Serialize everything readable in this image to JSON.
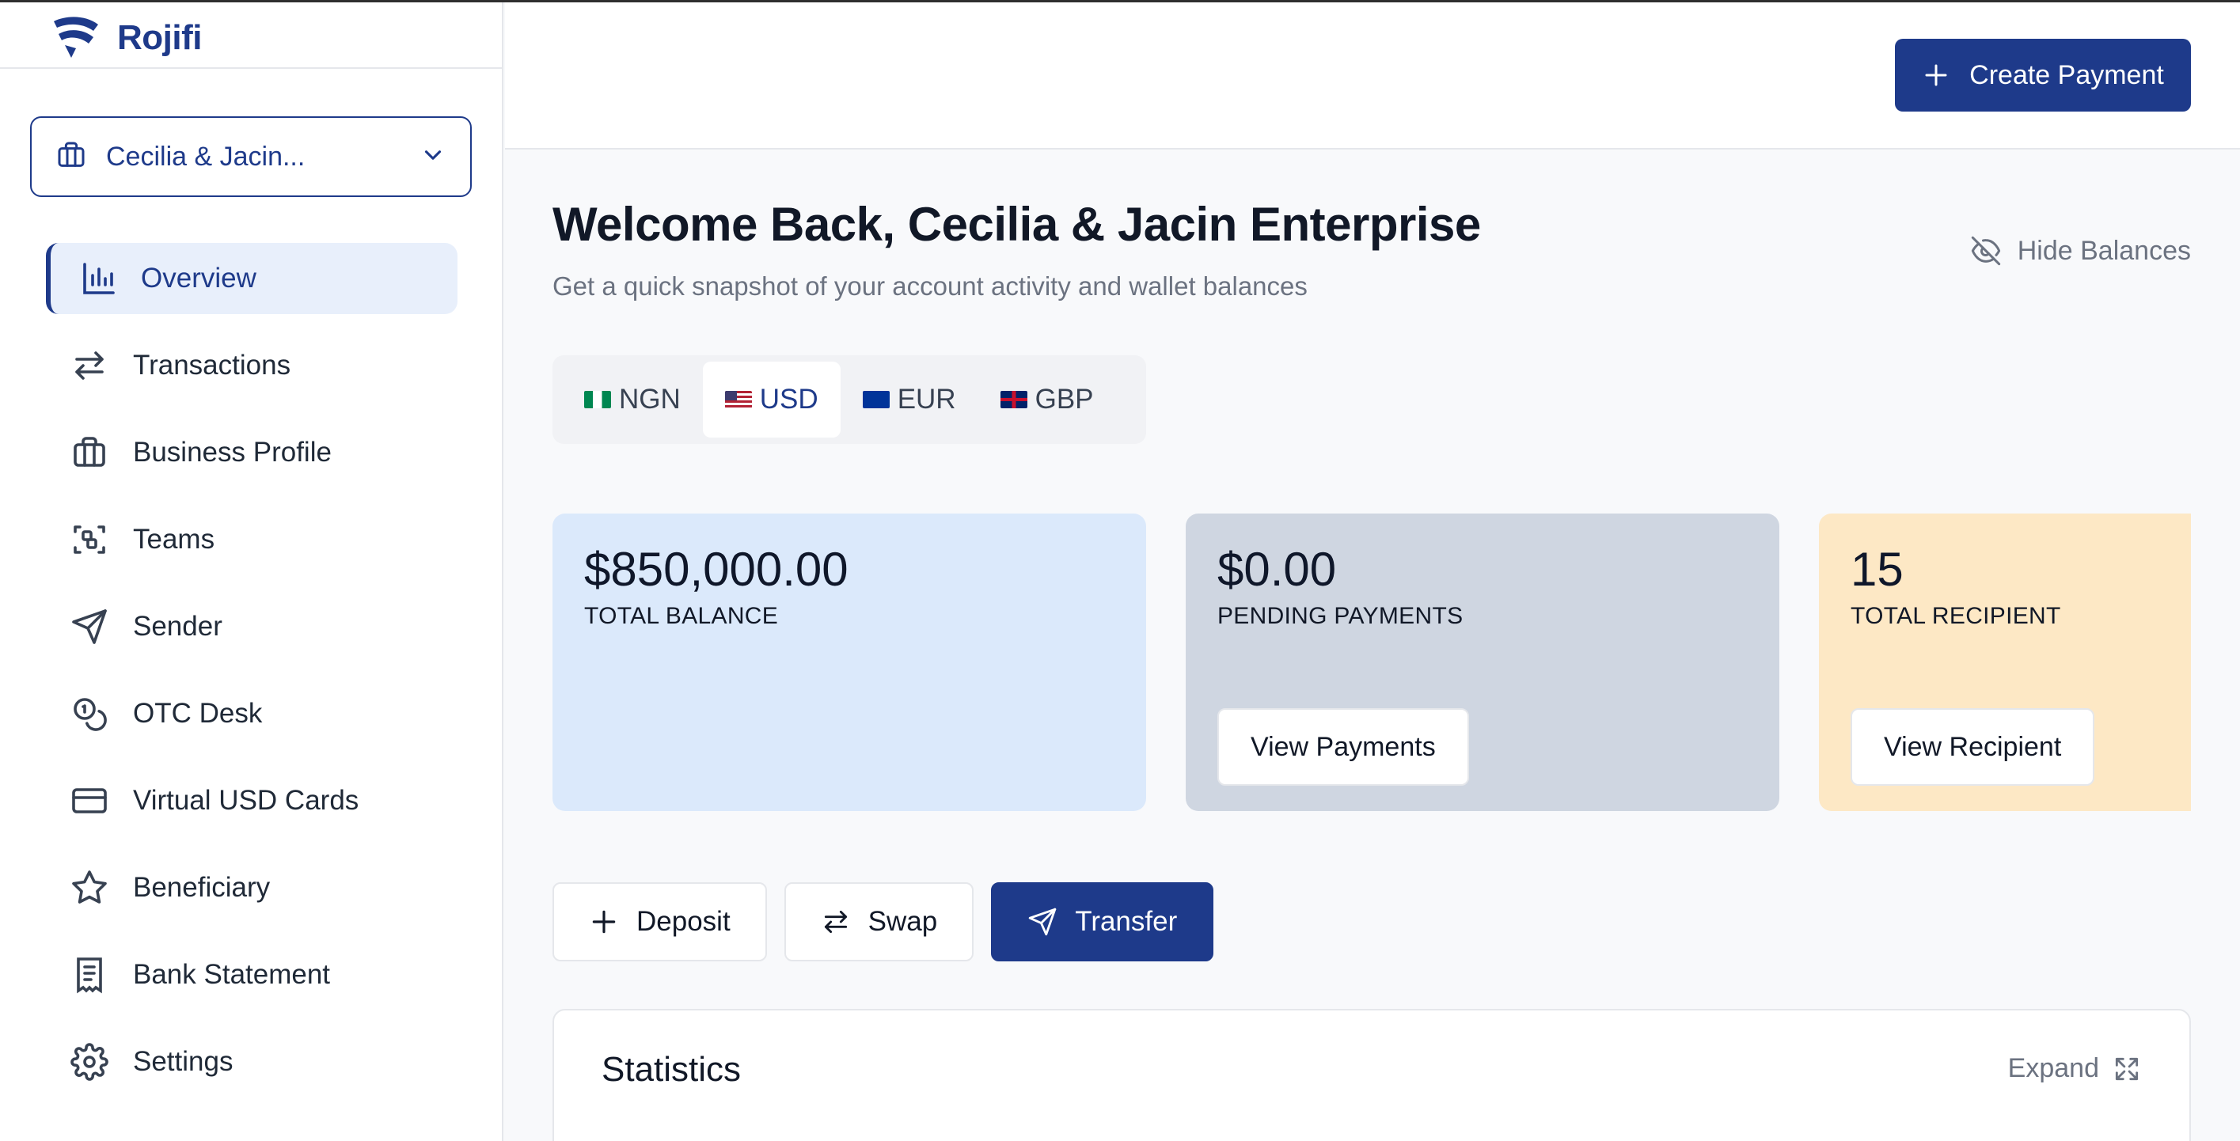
{
  "brand": {
    "name": "Rojifi",
    "logo_icon": "rojifi-logo-icon"
  },
  "business_selector": {
    "label": "Cecilia & Jacin...",
    "icon": "briefcase-icon",
    "chevron": "chevron-down-icon"
  },
  "sidebar": {
    "items": [
      {
        "label": "Overview",
        "icon": "bar-chart-icon",
        "active": true
      },
      {
        "label": "Transactions",
        "icon": "arrows-swap-icon"
      },
      {
        "label": "Business Profile",
        "icon": "briefcase-icon"
      },
      {
        "label": "Teams",
        "icon": "scan-people-icon"
      },
      {
        "label": "Sender",
        "icon": "send-icon"
      },
      {
        "label": "OTC Desk",
        "icon": "coins-icon"
      },
      {
        "label": "Virtual USD Cards",
        "icon": "credit-card-icon"
      },
      {
        "label": "Beneficiary",
        "icon": "star-icon"
      },
      {
        "label": "Bank Statement",
        "icon": "receipt-icon"
      },
      {
        "label": "Settings",
        "icon": "gear-icon"
      }
    ]
  },
  "header": {
    "create_payment_label": "Create Payment"
  },
  "main": {
    "welcome": "Welcome Back, Cecilia & Jacin Enterprise",
    "subtitle": "Get a quick snapshot of your account activity and wallet balances",
    "hide_balances_label": "Hide Balances",
    "currency_tabs": [
      {
        "code": "NGN",
        "active": false
      },
      {
        "code": "USD",
        "active": true
      },
      {
        "code": "EUR",
        "active": false
      },
      {
        "code": "GBP",
        "active": false
      }
    ],
    "cards": {
      "total_balance": {
        "amount": "$850,000.00",
        "label": "TOTAL BALANCE"
      },
      "pending_payments": {
        "amount": "$0.00",
        "label": "PENDING PAYMENTS",
        "button": "View Payments"
      },
      "total_recipient": {
        "amount": "15",
        "label": "TOTAL RECIPIENT",
        "button": "View Recipient"
      }
    },
    "actions": {
      "deposit": "Deposit",
      "swap": "Swap",
      "transfer": "Transfer"
    },
    "statistics": {
      "title": "Statistics",
      "expand_label": "Expand"
    }
  },
  "colors": {
    "primary": "#1e3a8a",
    "card_blue": "#dbe9fb",
    "card_grey": "#cfd6e1",
    "card_amber": "#fde8c5"
  }
}
